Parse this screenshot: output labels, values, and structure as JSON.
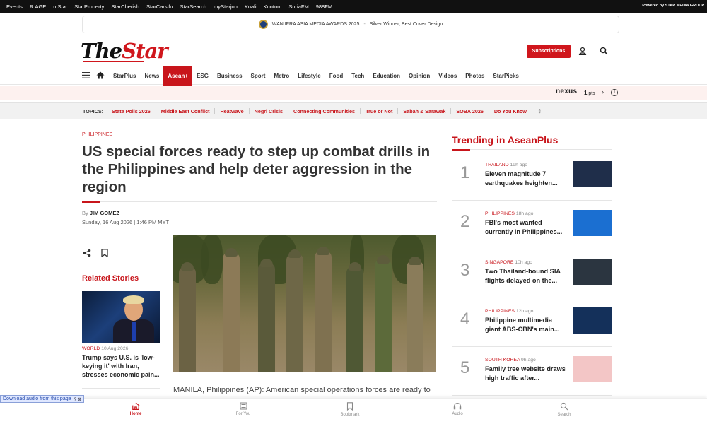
{
  "topbar": {
    "links": [
      "Events",
      "R.AGE",
      "mStar",
      "StarProperty",
      "StarCherish",
      "StarCarsifu",
      "StarSearch",
      "myStarjob",
      "Kuali",
      "Kuntum",
      "SuriaFM",
      "988FM"
    ],
    "powered": "Powered by STAR MEDIA GROUP"
  },
  "award": {
    "title": "WAN IFRA ASIA MEDIA AWARDS 2025",
    "sep": "-",
    "detail": "Silver Winner, Best Cover Design"
  },
  "header": {
    "logo_the": "The",
    "logo_star": "Star",
    "subscribe_label": "Subscriptions"
  },
  "nav": {
    "items": [
      "StarPlus",
      "News",
      "Asean+",
      "ESG",
      "Business",
      "Sport",
      "Metro",
      "Lifestyle",
      "Food",
      "Tech",
      "Education",
      "Opinion",
      "Videos",
      "Photos",
      "StarPicks"
    ],
    "active": "Asean+"
  },
  "nexus": {
    "brand": "nexus",
    "points": "1",
    "points_unit": "pts"
  },
  "topics": {
    "label": "TOPICS:",
    "items": [
      "State Polls 2026",
      "Middle East Conflict",
      "Heatwave",
      "Negri Crisis",
      "Connecting Communities",
      "True or Not",
      "Sabah & Sarawak",
      "SOBA 2026",
      "Do You Know"
    ]
  },
  "article": {
    "kicker": "PHILIPPINES",
    "headline": "US special forces ready to step up combat drills in the Philippines and help deter aggression in the region",
    "by": "By",
    "author": "JIM GOMEZ",
    "date": "Sunday, 16 Aug 2026 | 1:46 PM MYT",
    "body_start": "MANILA, Philippines (AP): American special operations forces are ready to"
  },
  "related": {
    "title": "Related Stories",
    "items": [
      {
        "category": "WORLD",
        "date": "10 Aug 2026",
        "headline": "Trump says U.S. is 'low-keying it' with Iran, stresses economic pain..."
      }
    ]
  },
  "trending": {
    "title": "Trending in AseanPlus",
    "items": [
      {
        "num": "1",
        "category": "THAILAND",
        "time": "19h ago",
        "title": "Eleven magnitude 7 earthquakes heighten...",
        "thumb_color": "#1f2e4a"
      },
      {
        "num": "2",
        "category": "PHILIPPINES",
        "time": "18h ago",
        "title": "FBI's most wanted currently in Philippines...",
        "thumb_color": "#1b6fd1"
      },
      {
        "num": "3",
        "category": "SINGAPORE",
        "time": "10h ago",
        "title": "Two Thailand-bound SIA flights delayed on the...",
        "thumb_color": "#2b3540"
      },
      {
        "num": "4",
        "category": "PHILIPPINES",
        "time": "12h ago",
        "title": "Philippine multimedia giant ABS-CBN's main...",
        "thumb_color": "#14305a"
      },
      {
        "num": "5",
        "category": "SOUTH KOREA",
        "time": "9h ago",
        "title": "Family tree website draws high traffic after...",
        "thumb_color": "#f3c6c6"
      }
    ]
  },
  "bottom_nav": {
    "items": [
      "Home",
      "For You",
      "Bookmark",
      "Audio",
      "Search"
    ],
    "active": "Home"
  },
  "audio_download": {
    "label": "Download audio from this page",
    "controls": "? ⊠"
  },
  "colors": {
    "brand_red": "#c8151b",
    "topbar": "#111111",
    "nexus_bg": "#fdf1ef",
    "topics_bg": "#f1f1f1"
  }
}
